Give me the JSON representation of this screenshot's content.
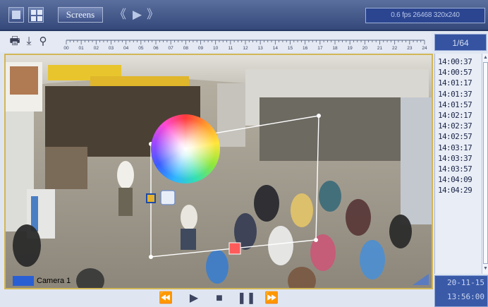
{
  "topbar": {
    "screens_label": "Screens",
    "status_text": "0.6 fps  26468  320x240"
  },
  "toolbar": {
    "ruler_ticks": [
      "00",
      "01",
      "02",
      "03",
      "04",
      "05",
      "06",
      "07",
      "08",
      "09",
      "10",
      "11",
      "12",
      "13",
      "14",
      "15",
      "16",
      "17",
      "18",
      "19",
      "20",
      "21",
      "22",
      "23",
      "24"
    ],
    "page_indicator": "1/64"
  },
  "time_list": [
    "14:00:37",
    "14:00:57",
    "14:01:17",
    "14:01:37",
    "14:01:57",
    "14:02:17",
    "14:02:37",
    "14:02:57",
    "14:03:17",
    "14:03:37",
    "14:03:57",
    "14:04:09",
    "14:04:29"
  ],
  "video": {
    "camera_label": "Camera 1"
  },
  "datetime": {
    "date": "20-11-15",
    "time": "13:56:00"
  },
  "icons": {
    "nav_back": "double-chevron-left-icon",
    "nav_play": "play-icon",
    "nav_forward": "double-chevron-right-icon",
    "print": "printer-icon",
    "download": "download-icon",
    "zoom": "magnifier-icon"
  },
  "colors": {
    "topbar": "#3e5289",
    "accent_box": "#3553a0",
    "frame_border": "#d2b656"
  }
}
